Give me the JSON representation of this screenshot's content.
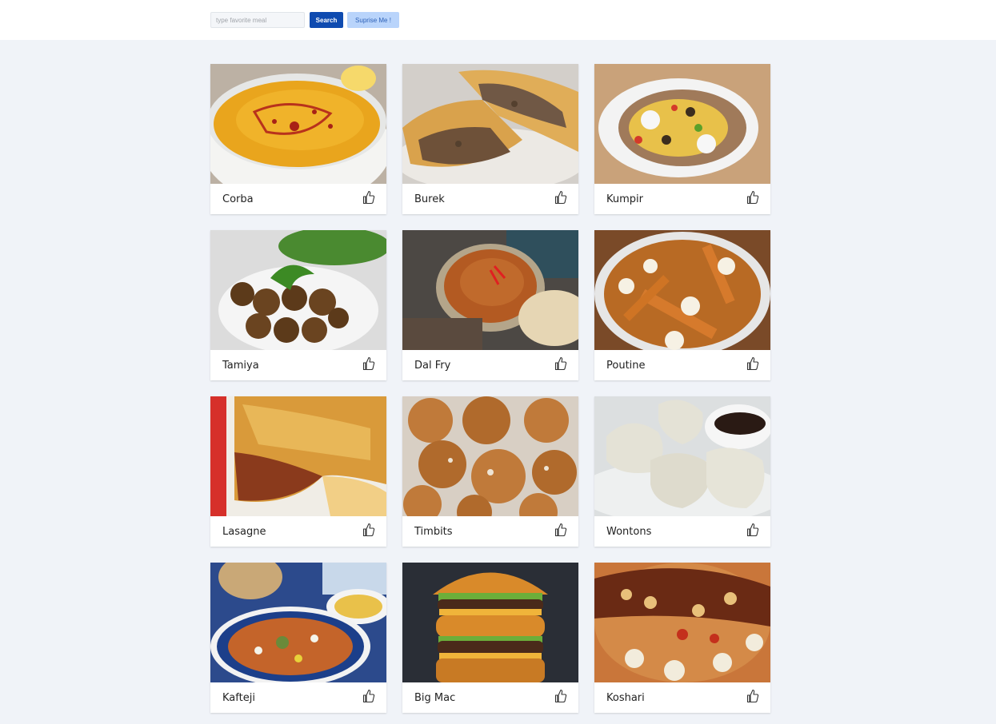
{
  "search": {
    "placeholder": "type favorite meal",
    "value": "",
    "button_label": "Search",
    "surprise_label": "Suprise Me !"
  },
  "colors": {
    "page_bg": "#f0f3f8",
    "primary": "#0f4bb0",
    "secondary": "#b9d4fb"
  },
  "meals": [
    {
      "name": "Corba",
      "icon": "thumbs-up-icon"
    },
    {
      "name": "Burek",
      "icon": "thumbs-up-icon"
    },
    {
      "name": "Kumpir",
      "icon": "thumbs-up-icon"
    },
    {
      "name": "Tamiya",
      "icon": "thumbs-up-icon"
    },
    {
      "name": "Dal Fry",
      "icon": "thumbs-up-icon"
    },
    {
      "name": "Poutine",
      "icon": "thumbs-up-icon"
    },
    {
      "name": "Lasagne",
      "icon": "thumbs-up-icon"
    },
    {
      "name": "Timbits",
      "icon": "thumbs-up-icon"
    },
    {
      "name": "Wontons",
      "icon": "thumbs-up-icon"
    },
    {
      "name": "Kafteji",
      "icon": "thumbs-up-icon"
    },
    {
      "name": "Big Mac",
      "icon": "thumbs-up-icon"
    },
    {
      "name": "Koshari",
      "icon": "thumbs-up-icon"
    }
  ]
}
